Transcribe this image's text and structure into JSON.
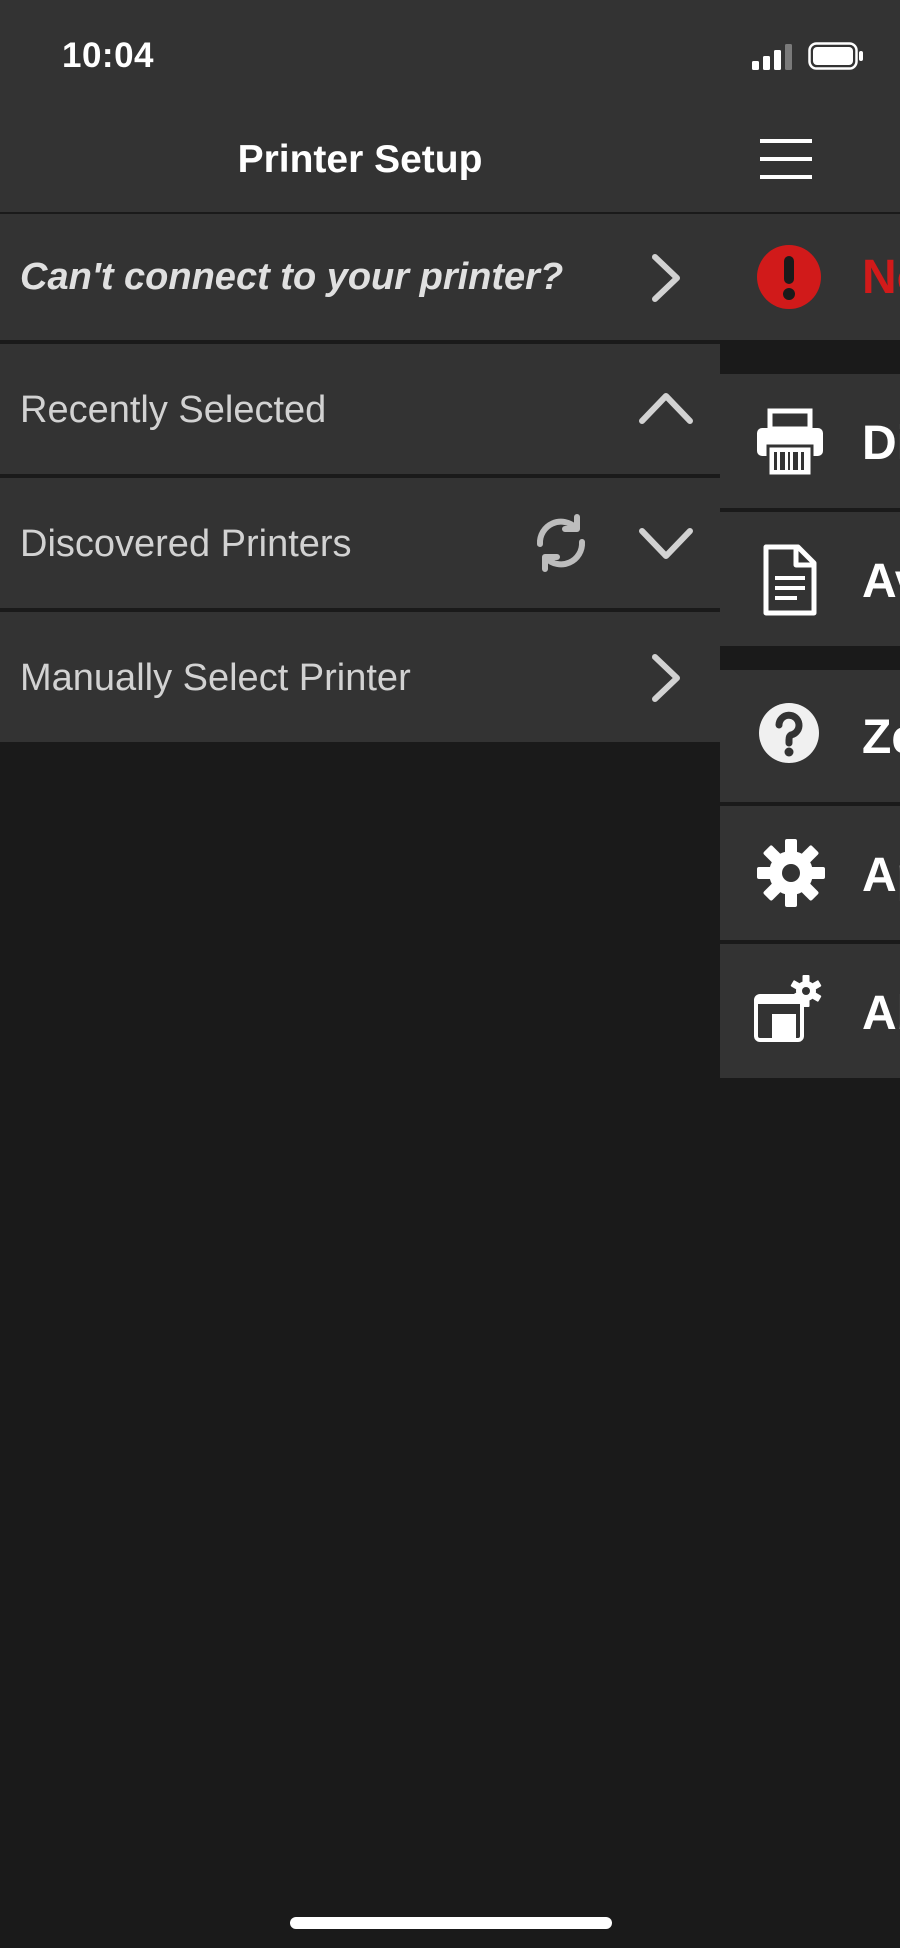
{
  "status_bar": {
    "time": "10:04"
  },
  "header": {
    "title": "Printer Setup"
  },
  "rows": {
    "help": {
      "label": "Can't connect to your printer?"
    },
    "recent": {
      "label": "Recently Selected",
      "expanded": true
    },
    "discovered": {
      "label": "Discovered Printers",
      "expanded": false
    },
    "manual": {
      "label": "Manually Select Printer"
    }
  },
  "side_menu": {
    "items": [
      {
        "label": "No",
        "icon": "alert-icon",
        "color": "#d11a1a"
      },
      {
        "label": "Di",
        "icon": "printer-icon"
      },
      {
        "label": "Av",
        "icon": "document-icon"
      },
      {
        "label": "Ze",
        "icon": "help-icon"
      },
      {
        "label": "Ap",
        "icon": "gear-icon"
      },
      {
        "label": "Ab",
        "icon": "about-icon"
      }
    ]
  },
  "colors": {
    "bar": "#333333",
    "background": "#1a1a1a",
    "alert": "#d11a1a",
    "text": "#d2d2d2"
  }
}
